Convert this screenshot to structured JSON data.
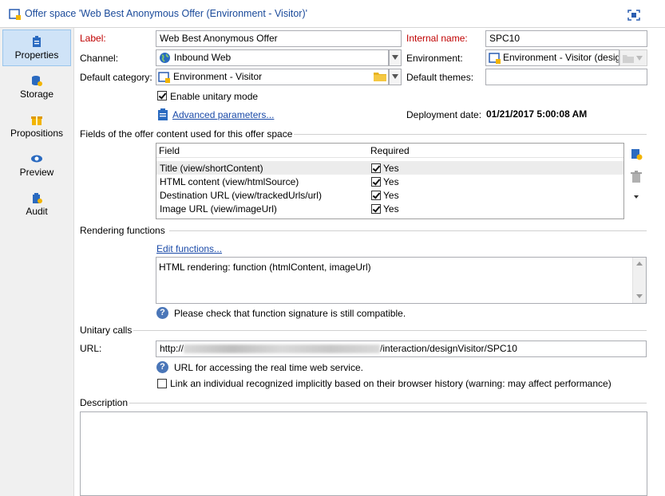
{
  "window": {
    "title": "Offer space 'Web Best Anonymous Offer (Environment - Visitor)'"
  },
  "sidebar": {
    "items": [
      {
        "label": "Properties",
        "icon": "properties-icon"
      },
      {
        "label": "Storage",
        "icon": "storage-icon"
      },
      {
        "label": "Propositions",
        "icon": "propositions-icon"
      },
      {
        "label": "Preview",
        "icon": "preview-icon"
      },
      {
        "label": "Audit",
        "icon": "audit-icon"
      }
    ]
  },
  "form": {
    "label_caption": "Label:",
    "label_value": "Web Best Anonymous Offer",
    "internal_name_caption": "Internal name:",
    "internal_name_value": "SPC10",
    "channel_caption": "Channel:",
    "channel_value": "Inbound Web",
    "environment_caption": "Environment:",
    "environment_value": "Environment - Visitor (desig",
    "default_category_caption": "Default category:",
    "default_category_value": "Environment - Visitor",
    "default_themes_caption": "Default themes:",
    "default_themes_value": "",
    "enable_unitary_label": "Enable unitary mode",
    "enable_unitary_checked": true,
    "advanced_parameters_link": "Advanced parameters...",
    "deployment_date_caption": "Deployment date:",
    "deployment_date_value": "01/21/2017 5:00:08 AM"
  },
  "fields_section": {
    "title": "Fields of the offer content used for this offer space",
    "columns": [
      "Field",
      "Required"
    ],
    "rows": [
      {
        "field": "Title (view/shortContent)",
        "required": "Yes"
      },
      {
        "field": "HTML content (view/htmlSource)",
        "required": "Yes"
      },
      {
        "field": "Destination URL (view/trackedUrls/url)",
        "required": "Yes"
      },
      {
        "field": "Image URL (view/imageUrl)",
        "required": "Yes"
      }
    ]
  },
  "rendering": {
    "title": "Rendering functions",
    "edit_link": "Edit functions...",
    "content": "HTML rendering: function (htmlContent, imageUrl)",
    "hint": "Please check that function signature is still compatible."
  },
  "unitary": {
    "title": "Unitary calls",
    "url_caption": "URL:",
    "url_prefix": "http://",
    "url_suffix": "/interaction/designVisitor/SPC10",
    "url_hint": "URL for accessing the real time web service.",
    "link_checkbox_label": "Link an individual recognized implicitly based on their browser history (warning: may affect performance)",
    "link_checked": false
  },
  "description": {
    "title": "Description",
    "value": ""
  },
  "colors": {
    "accent": "#1a4a9a",
    "required_label": "#c00000",
    "selected_nav": "#cfe3f7"
  }
}
